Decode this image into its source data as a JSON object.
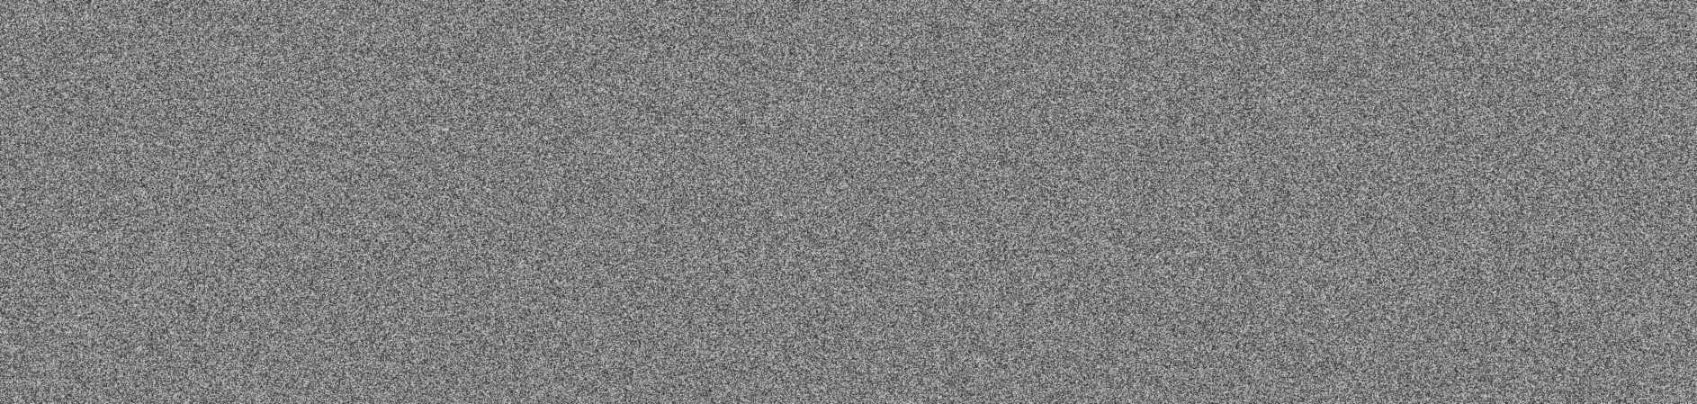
{
  "background": {
    "pattern": "random-gray-noise",
    "base_color": "#7a7a7a",
    "text_color": "#e6e6e6"
  },
  "paragraphs": [
    "",
    "",
    ""
  ]
}
